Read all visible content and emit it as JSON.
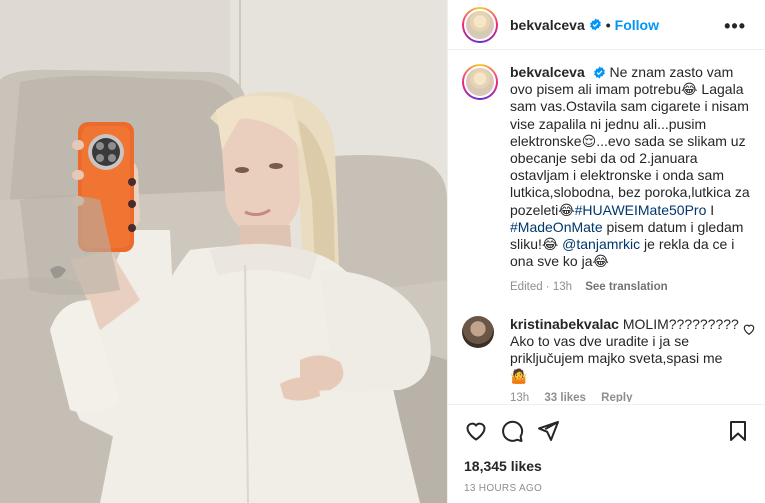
{
  "post": {
    "username": "bekvalceva",
    "separator": "•",
    "follow_label": "Follow",
    "more_icon": "more-options-icon",
    "verified_icon": "verified-badge-icon"
  },
  "caption": {
    "username": "bekvalceva",
    "text_1": "Ne znam zasto vam ovo pisem ali imam potrebu😂 Lagala sam vas.Ostavila sam cigarete i nisam vise zapalila ni jednu ali...pusim elektronske😌...evo sada se slikam uz obecanje sebi da od 2.januara ostavljam i elektronske i onda sam lutkica,slobodna, bez poroka,lutkica za pozeleti😂",
    "hashtag_1": "#HUAWEIMate50Pro",
    "text_2": " I ",
    "hashtag_2": "#MadeOnMate",
    "text_3": " pisem datum i gledam sliku!😂 ",
    "mention": "@tanjamrkic",
    "text_4": " je rekla da ce i ona sve ko ja😂",
    "edited": "Edited",
    "meta_sep": " · ",
    "time": "13h",
    "see_translation": "See translation"
  },
  "comment": {
    "username": "kristinabekvalac",
    "text": "MOLIM????????? Ako to vas dve uradite i ja se priključujem majko sveta,spasi me 🤷",
    "time": "13h",
    "likes": "33 likes",
    "reply": "Reply"
  },
  "actions": {
    "like_icon": "heart-icon",
    "comment_icon": "comment-icon",
    "share_icon": "share-icon",
    "save_icon": "bookmark-icon",
    "likes_count": "18,345 likes",
    "posted_ago": "13 HOURS AGO"
  },
  "colors": {
    "link_blue": "#0095f6",
    "hashtag": "#00376b",
    "muted": "#8e8e8e"
  }
}
